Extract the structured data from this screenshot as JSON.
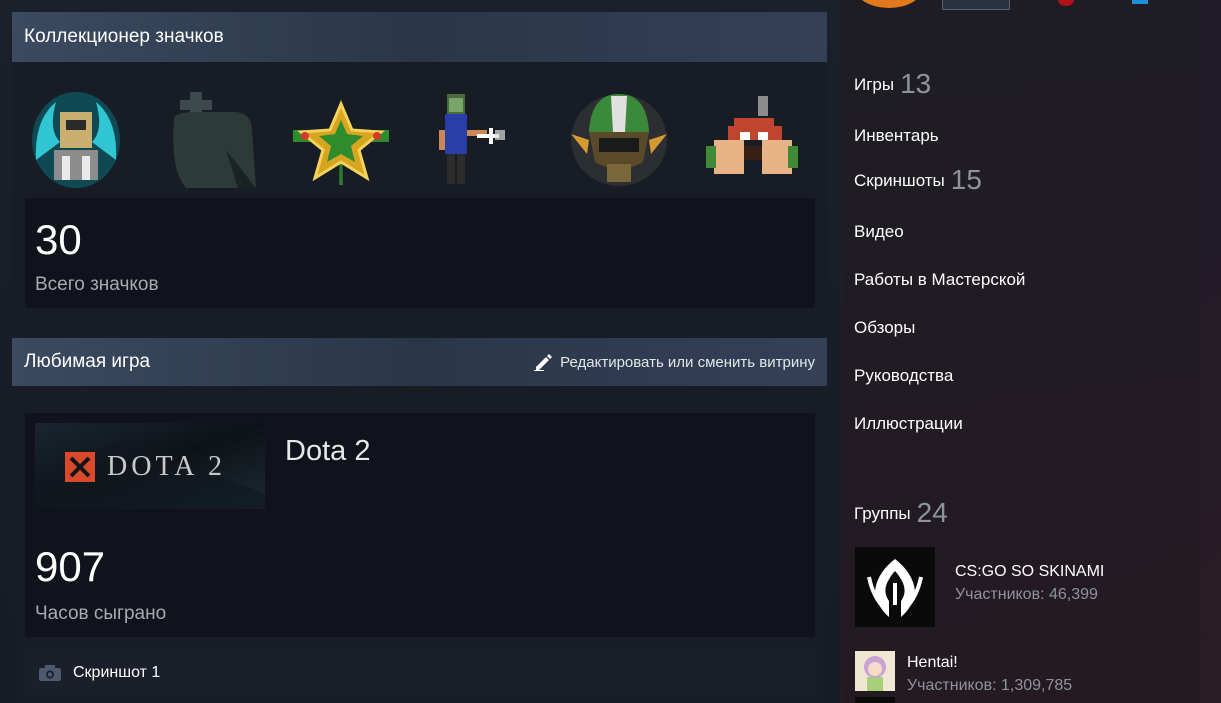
{
  "badge_collector": {
    "title": "Коллекционер значков",
    "badges": [
      "dragon-knight-badge",
      "gravestone-badge",
      "gold-star-badge",
      "pixel-scientist-badge",
      "soldier-helmet-badge",
      "pixel-fist-badge"
    ],
    "total": "30",
    "total_label": "Всего значков"
  },
  "favorite_game": {
    "title": "Любимая игра",
    "edit_label": "Редактировать или сменить витрину",
    "game_logo_text": "DOTA 2",
    "game_name": "Dota 2",
    "hours": "907",
    "hours_label": "Часов сыграно",
    "screenshot_label": "Скриншот 1"
  },
  "sidebar": {
    "items": [
      {
        "label": "Игры",
        "count": "13"
      },
      {
        "label": "Инвентарь",
        "count": ""
      },
      {
        "label": "Скриншоты",
        "count": "15"
      },
      {
        "label": "Видео",
        "count": ""
      },
      {
        "label": "Работы в Мастерской",
        "count": ""
      },
      {
        "label": "Обзоры",
        "count": ""
      },
      {
        "label": "Руководства",
        "count": ""
      },
      {
        "label": "Иллюстрации",
        "count": ""
      }
    ],
    "groups": {
      "label": "Группы",
      "count": "24",
      "list": [
        {
          "name": "CS:GO SO SKINAMI",
          "members": "Участников: 46,399"
        },
        {
          "name": "Hentai!",
          "members": "Участников: 1,309,785"
        }
      ]
    }
  },
  "colors": {
    "accent_header": "#3b4a60",
    "muted_text": "#8e949d",
    "dota_red": "#e2502e"
  }
}
